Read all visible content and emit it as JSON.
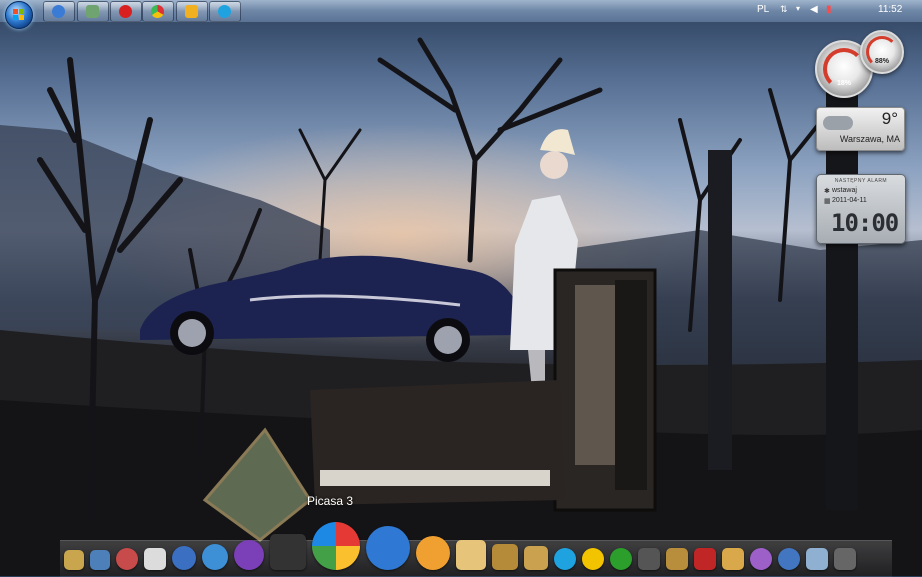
{
  "taskbar": {
    "start_button": "windows-start",
    "pinned": [
      {
        "name": "winamp",
        "icon": "winamp-icon",
        "color": "#3a7bd5"
      },
      {
        "name": "explorer",
        "icon": "folder-windows-icon",
        "color": "#6fa36f"
      },
      {
        "name": "opera",
        "icon": "opera-icon",
        "color": "#d82020"
      },
      {
        "name": "chrome",
        "icon": "chrome-icon",
        "color": "#e8c020"
      },
      {
        "name": "notes",
        "icon": "sticky-note-icon",
        "color": "#f0b020"
      },
      {
        "name": "skype",
        "icon": "skype-icon",
        "color": "#1fa3e0"
      }
    ],
    "tray": {
      "language": "PL",
      "time": "11:52"
    }
  },
  "gadgets": {
    "cpu_meter": {
      "left_value": "18%",
      "right_value": "88%"
    },
    "weather": {
      "temperature": "9°",
      "location": "Warszawa, MA"
    },
    "alarm": {
      "header": "NASTĘPNY ALARM",
      "name": "wstawaj",
      "date": "2011-04-11",
      "time": "10:00"
    }
  },
  "dock": {
    "tooltip": "Picasa 3",
    "icons": [
      "user-folder-icon",
      "computer-icon",
      "paint-palette-icon",
      "document-icon",
      "globe-icon",
      "safari-icon",
      "imvu-icon",
      "film-reel-icon",
      "picasa-icon",
      "lightning-icon",
      "palette-icon",
      "notepad-icon",
      "folder-icon",
      "photo-icon",
      "skype-icon",
      "smiley-icon",
      "utorrent-icon",
      "clapboard-icon",
      "pen-icon",
      "lips-icon",
      "office-icon",
      "eye-icon",
      "network-icon",
      "trash-icon",
      "tray-icon"
    ],
    "icon_colors": [
      "#c9a64e",
      "#4d7fb8",
      "#c84b4b",
      "#dcdcdc",
      "#3a6fc2",
      "#3d8fd6",
      "#7b3fb7",
      "#333333",
      "#e8e8e8",
      "#2f79d4",
      "#f0a030",
      "#e6c57a",
      "#b58b3a",
      "#caa14e",
      "#1fa3e0",
      "#f2c400",
      "#2b9e2b",
      "#555555",
      "#b88d3b",
      "#c02626",
      "#d8a84b",
      "#9d5fc8",
      "#4276c0",
      "#8fb0d0",
      "#666666"
    ]
  }
}
